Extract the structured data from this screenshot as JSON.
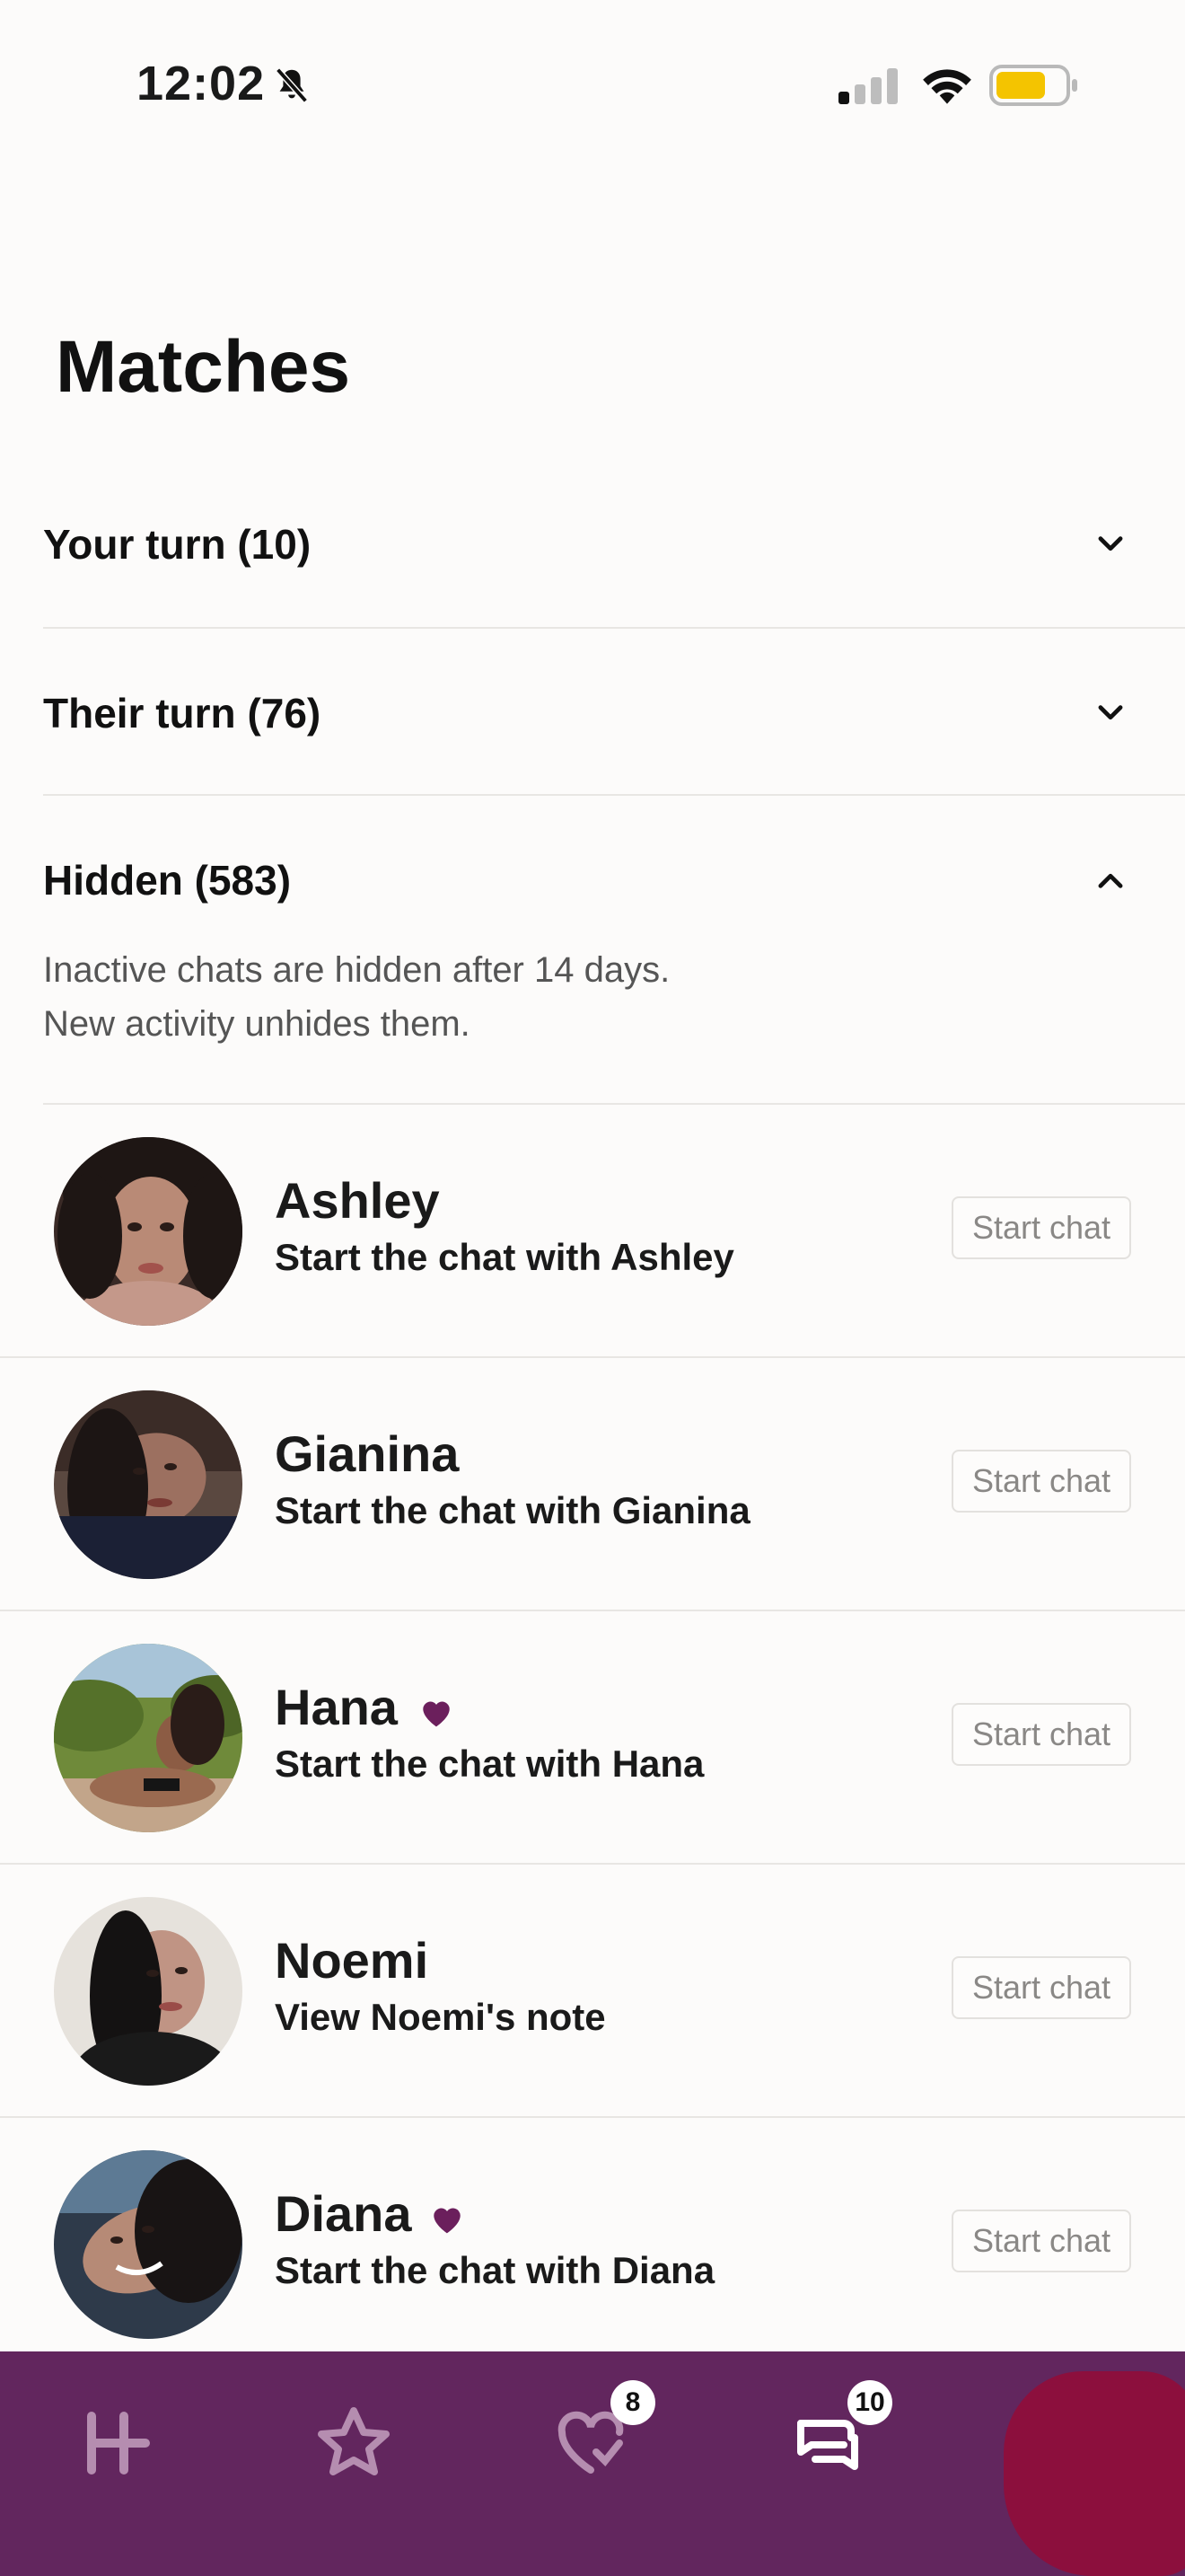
{
  "status_bar": {
    "time": "12:02"
  },
  "page_title": "Matches",
  "sections": [
    {
      "label": "Your turn (10)",
      "expanded": false
    },
    {
      "label": "Their turn (76)",
      "expanded": false
    },
    {
      "label": "Hidden (583)",
      "expanded": true
    }
  ],
  "hidden_note": {
    "line1": "Inactive chats are hidden after 14 days.",
    "line2": "New activity unhides them."
  },
  "matches": [
    {
      "name": "Ashley",
      "subtitle": "Start the chat with Ashley",
      "liked": false,
      "action": "Start chat"
    },
    {
      "name": "Gianina",
      "subtitle": "Start the chat with Gianina",
      "liked": false,
      "action": "Start chat"
    },
    {
      "name": "Hana",
      "subtitle": "Start the chat with Hana",
      "liked": true,
      "action": "Start chat"
    },
    {
      "name": "Noemi",
      "subtitle": "View Noemi's note",
      "liked": false,
      "action": "Start chat"
    },
    {
      "name": "Diana",
      "subtitle": "Start the chat with Diana",
      "liked": true,
      "action": "Start chat"
    }
  ],
  "bottom_nav": {
    "items": [
      {
        "icon": "home-logo-icon",
        "badge": null
      },
      {
        "icon": "star-icon",
        "badge": null
      },
      {
        "icon": "likes-heart-icon",
        "badge": "8"
      },
      {
        "icon": "chat-bubbles-icon",
        "badge": "10"
      },
      {
        "icon": "profile-icon",
        "badge": null
      }
    ]
  },
  "colors": {
    "background": "#fcfbfa",
    "nav_background": "#62265e",
    "heart": "#6b1f5c",
    "battery": "#f4c400"
  }
}
